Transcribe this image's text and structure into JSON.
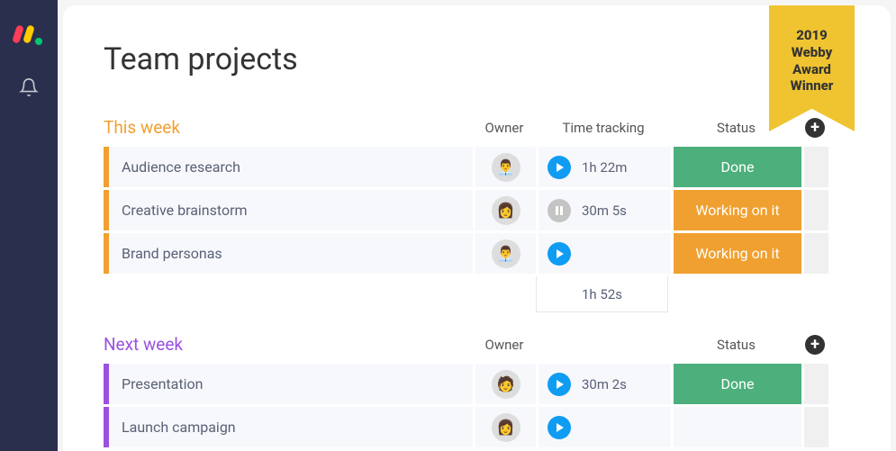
{
  "ribbon": {
    "line1": "2019",
    "line2": "Webby",
    "line3": "Award",
    "line4": "Winner"
  },
  "page_title": "Team projects",
  "columns": {
    "owner": "Owner",
    "time_tracking": "Time tracking",
    "status": "Status"
  },
  "status_labels": {
    "done": "Done",
    "working": "Working on it"
  },
  "groups": [
    {
      "title": "This week",
      "color": "orange",
      "show_time_tracking": true,
      "rows": [
        {
          "name": "Audience research",
          "owner_avatar": "👨‍💼",
          "track_state": "play",
          "track_time": "1h 22m",
          "status": "done"
        },
        {
          "name": "Creative brainstorm",
          "owner_avatar": "👩",
          "track_state": "pause",
          "track_time": "30m 5s",
          "status": "working"
        },
        {
          "name": "Brand personas",
          "owner_avatar": "👨‍💼",
          "track_state": "play",
          "track_time": "",
          "status": "working"
        }
      ],
      "total_time": "1h 52s"
    },
    {
      "title": "Next week",
      "color": "purple",
      "show_time_tracking": false,
      "rows": [
        {
          "name": "Presentation",
          "owner_avatar": "🧑",
          "track_state": "play",
          "track_time": "30m 2s",
          "status": "done"
        },
        {
          "name": "Launch campaign",
          "owner_avatar": "👩",
          "track_state": "play",
          "track_time": "",
          "status": ""
        }
      ],
      "total_time": ""
    }
  ]
}
